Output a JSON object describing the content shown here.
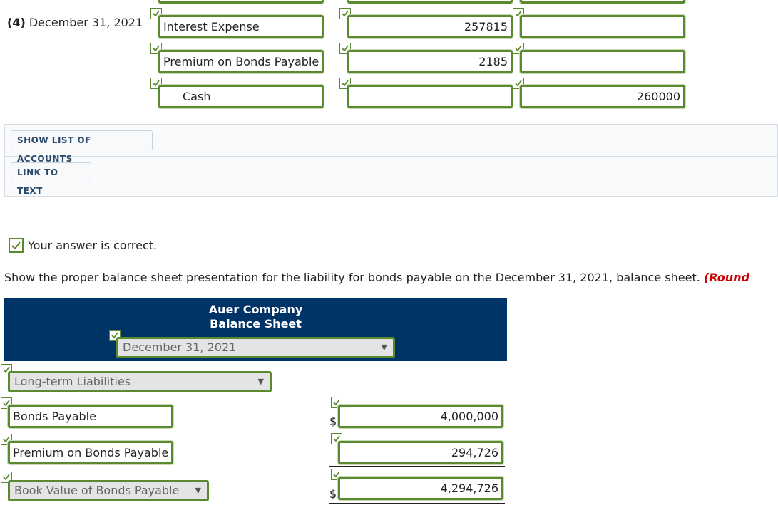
{
  "journal": {
    "entry_label": "(4)",
    "entry_date": "December 31, 2021",
    "rows": [
      {
        "account": "Interest Expense",
        "debit": "257815",
        "credit": ""
      },
      {
        "account": "Premium on Bonds Payable",
        "debit": "2185",
        "credit": ""
      },
      {
        "account": "Cash",
        "debit": "",
        "credit": "260000"
      }
    ]
  },
  "buttons": {
    "show_list": "SHOW LIST OF ACCOUNTS",
    "link_text": "LINK TO TEXT"
  },
  "feedback": {
    "correct": "Your answer is correct."
  },
  "question": {
    "text": "Show the proper balance sheet presentation for the liability for bonds payable on the December 31, 2021, balance sheet.",
    "emphasis": "(Round"
  },
  "balance_sheet": {
    "company": "Auer Company",
    "statement": "Balance Sheet",
    "date_select": "December 31, 2021",
    "section_select": "Long-term Liabilities",
    "rows": [
      {
        "account": "Bonds Payable",
        "currency": "$",
        "amount": "4,000,000"
      },
      {
        "account": "Premium on Bonds Payable",
        "currency": "",
        "amount": "294,726"
      },
      {
        "account": "Book Value of Bonds Payable",
        "currency": "$",
        "amount": "4,294,726"
      }
    ]
  },
  "colors": {
    "accent_green": "#5a8a2e",
    "header_navy": "#003366",
    "emphasis_red": "#cc0000"
  }
}
